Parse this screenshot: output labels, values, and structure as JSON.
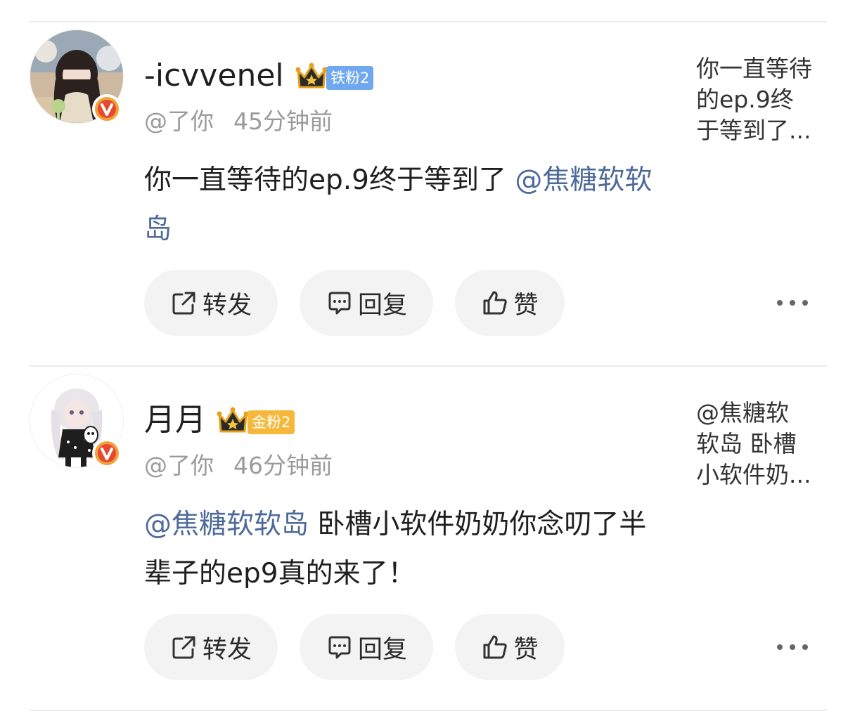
{
  "comments": [
    {
      "username": "-icvvenel",
      "fan_badge": "铁粉2",
      "handle": "@了你",
      "time": "45分钟前",
      "content_parts": [
        {
          "text": "你一直等待的ep.9终于等到了 ",
          "mention": false
        },
        {
          "text": "@焦糖软软岛",
          "mention": true
        }
      ],
      "preview_lines": [
        "你一直等待",
        "的ep.9终",
        "于等到了..."
      ],
      "actions": {
        "repost": "转发",
        "reply": "回复",
        "like": "赞"
      }
    },
    {
      "username": "月月",
      "fan_badge": "金粉2",
      "handle": "@了你",
      "time": "46分钟前",
      "content_parts": [
        {
          "text": "@焦糖软软岛",
          "mention": true
        },
        {
          "text": " 卧槽小软件奶奶你念叨了半辈子的ep9真的来了！",
          "mention": false
        }
      ],
      "preview_lines": [
        "@焦糖软",
        "软岛 卧槽",
        "小软件奶..."
      ],
      "actions": {
        "repost": "转发",
        "reply": "回复",
        "like": "赞"
      }
    }
  ],
  "colors": {
    "mention": "#4e6a9a",
    "iron_badge": "#6fa8f0",
    "gold_badge": "#f5b83a",
    "verified": "#f3a23a",
    "divider": "#ececec"
  },
  "icons": [
    "repost-icon",
    "reply-icon",
    "like-icon",
    "more-icon",
    "crown-icon",
    "verified-icon"
  ]
}
